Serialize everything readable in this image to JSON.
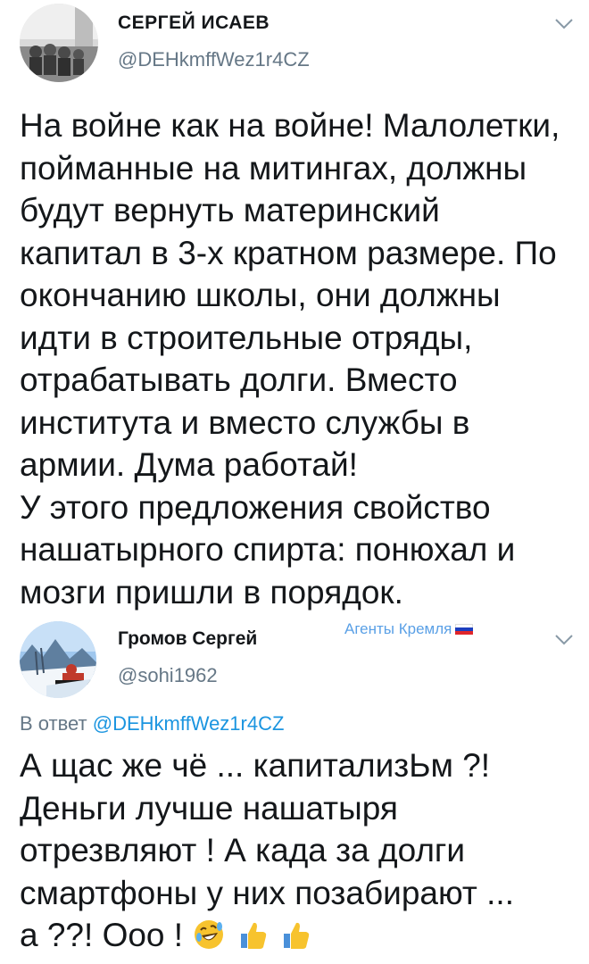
{
  "tweet1": {
    "author_name": "СЕРГЕЙ ИСАЕВ",
    "handle": "@DEHkmffWez1r4CZ",
    "menu_icon": "chevron-down-icon",
    "lines": [
      "На войне как на войне! Малолетки,",
      "пойманные на митингах, должны",
      "будут вернуть материнский",
      "капитал в 3-х кратном размере. По",
      "окончанию школы, они должны",
      "идти в строительные отряды,",
      "отрабатывать долги. Вместо",
      "института и вместо службы в",
      "армии. Дума работай!",
      "У этого предложения свойство",
      "нашатырного спирта: понюхал и",
      "мозги пришли в порядок."
    ]
  },
  "tweet2": {
    "author_name": "Громов Сергей",
    "handle": "@sohi1962",
    "label": "Агенты Кремля",
    "flag_colors": [
      "#ffffff",
      "#1c3fbf",
      "#e0262b"
    ],
    "menu_icon": "chevron-down-icon",
    "reply_prefix": "В ответ",
    "reply_mention": "@DEHkmffWez1r4CZ",
    "lines": [
      "А щас же чё ... капитализЬм ?!",
      "Деньги лучше нашатыря",
      "отрезвляют ! А када за долги",
      "смартфоны у них позабирают ...",
      "а ??! Ооо !"
    ],
    "emojis": [
      "rolling-on-floor-laughing-icon",
      "thumbs-up-icon",
      "thumbs-up-icon"
    ]
  }
}
